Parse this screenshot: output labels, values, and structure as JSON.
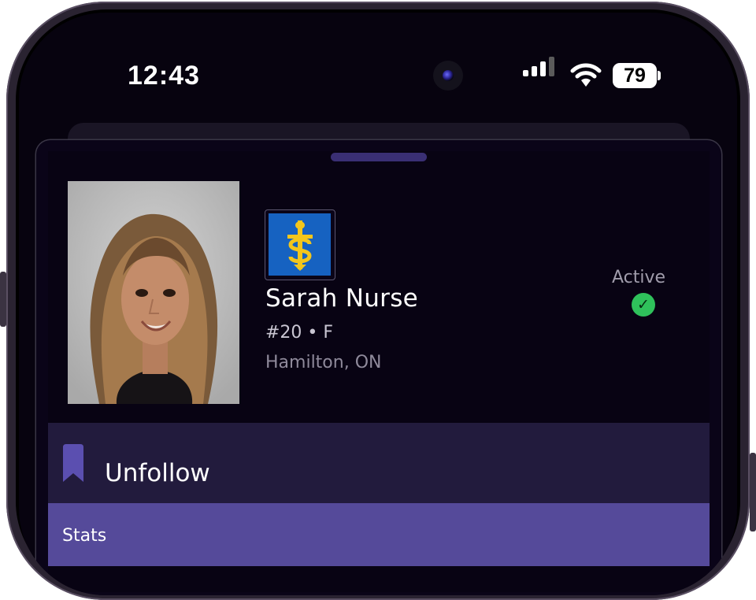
{
  "status_bar": {
    "time": "12:43",
    "battery": "79"
  },
  "player": {
    "name": "Sarah Nurse",
    "number_position": "#20 • F",
    "hometown": "Hamilton, ON",
    "team_logo_icon": "team-logo-icon",
    "photo": "player-headshot"
  },
  "status": {
    "label": "Active",
    "icon": "check-circle-icon",
    "color": "#2fc15b"
  },
  "follow": {
    "label": "Unfollow",
    "icon": "bookmark-icon"
  },
  "stats": {
    "label": "Stats"
  },
  "colors": {
    "background": "#080313",
    "follow_bar": "#221b3d",
    "stats_bar": "#554a9a",
    "accent": "#554a9a",
    "team_logo_bg": "#1662c1",
    "team_logo_gold": "#f3c61c"
  }
}
